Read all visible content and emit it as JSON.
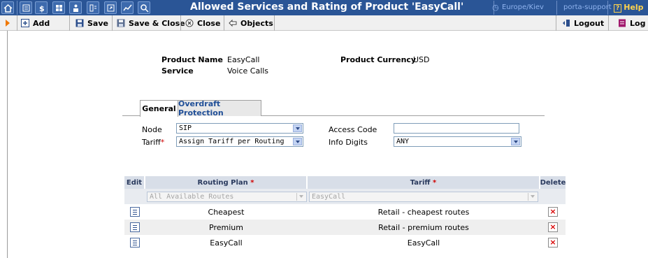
{
  "window": {
    "title": "Allowed Services and Rating of Product 'EasyCall'",
    "timezone": "Europe/Kiev",
    "user": "porta-support",
    "help": "Help"
  },
  "toolbar": {
    "add": "Add",
    "save": "Save",
    "save_close": "Save & Close",
    "close": "Close",
    "objects": "Objects",
    "logout": "Logout",
    "log": "Log"
  },
  "product": {
    "name_label": "Product Name",
    "name_value": "EasyCall",
    "service_label": "Service",
    "service_value": "Voice Calls",
    "currency_label": "Product Currency",
    "currency_value": "USD"
  },
  "tabs": [
    {
      "label": "General",
      "active": true
    },
    {
      "label": "Overdraft Protection",
      "active": false
    }
  ],
  "form": {
    "node_label": "Node",
    "node_value": "SIP",
    "tariff_label": "Tariff",
    "tariff_required": "*",
    "tariff_value": "Assign Tariff per Routing",
    "access_code_label": "Access Code",
    "access_code_value": "",
    "info_digits_label": "Info Digits",
    "info_digits_value": "ANY"
  },
  "table": {
    "headers": {
      "edit": "Edit",
      "routing_plan": "Routing Plan",
      "tariff": "Tariff",
      "delete": "Delete",
      "required": "*"
    },
    "filter": {
      "routing_plan": "All Available Routes",
      "tariff": "EasyCall"
    },
    "rows": [
      {
        "routing_plan": "Cheapest",
        "tariff": "Retail - cheapest routes"
      },
      {
        "routing_plan": "Premium",
        "tariff": "Retail - premium routes"
      },
      {
        "routing_plan": "EasyCall",
        "tariff": "EasyCall"
      }
    ]
  },
  "colors": {
    "titlebar": "#2a5596",
    "toolbar": "#f0f0f0",
    "header_bg": "#d8dee8",
    "required": "#d00000"
  }
}
